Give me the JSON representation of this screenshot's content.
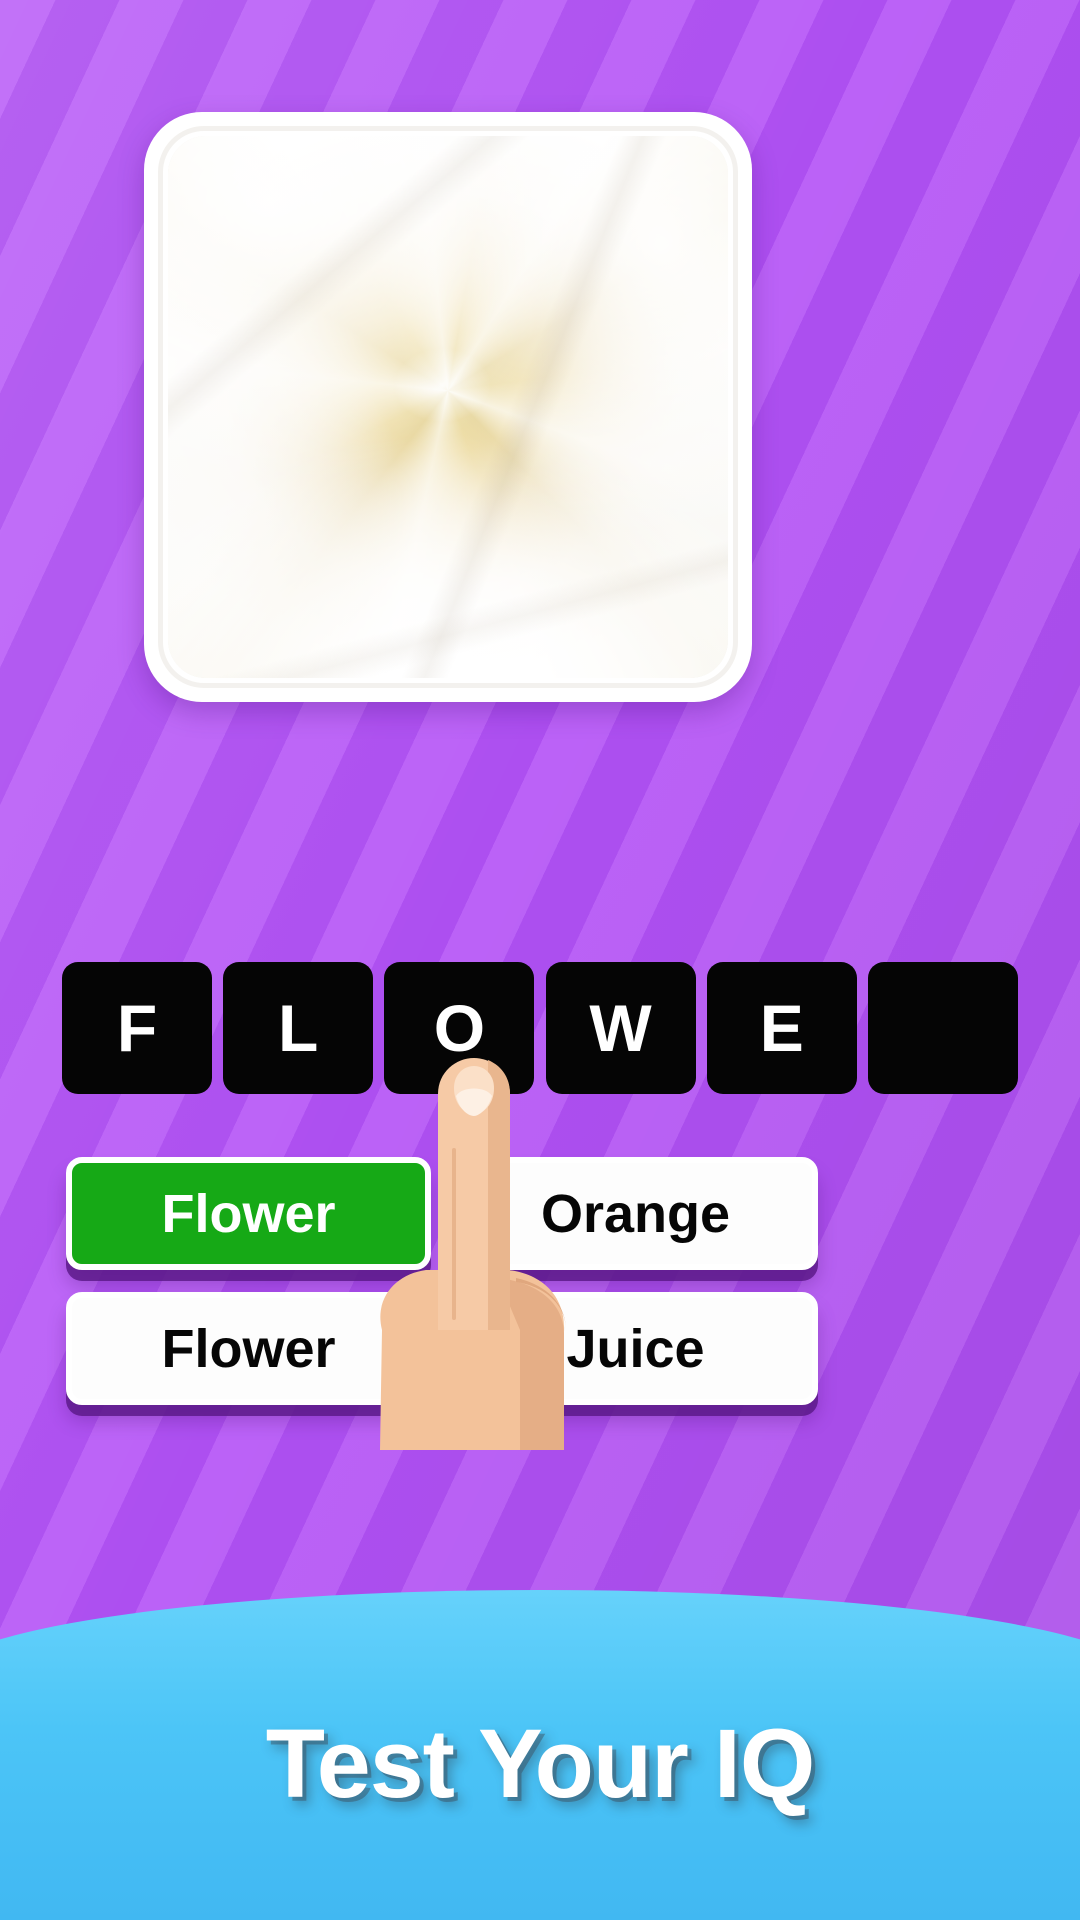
{
  "app": {
    "theme_background": "#b85cf5",
    "accent_correct": "#16a916",
    "tile_background": "#050505",
    "banner_background": "#4cc5f7"
  },
  "puzzle": {
    "image_subject": "white-rose-flower-closeup",
    "image_alt": "Close-up photograph of a white rose with a creamy yellow swirled center",
    "letters": [
      {
        "char": "F",
        "filled": true
      },
      {
        "char": "L",
        "filled": true
      },
      {
        "char": "O",
        "filled": true
      },
      {
        "char": "W",
        "filled": true
      },
      {
        "char": "E",
        "filled": true
      },
      {
        "char": "",
        "filled": false
      }
    ]
  },
  "answers": [
    {
      "label": "Flower",
      "state": "correct"
    },
    {
      "label": "Orange",
      "state": "default"
    },
    {
      "label": "Flower",
      "state": "default"
    },
    {
      "label": "Juice",
      "state": "default"
    }
  ],
  "cursor": {
    "icon": "pointing-hand-icon",
    "target_answer": "Flower"
  },
  "banner": {
    "title": "Test Your IQ"
  }
}
